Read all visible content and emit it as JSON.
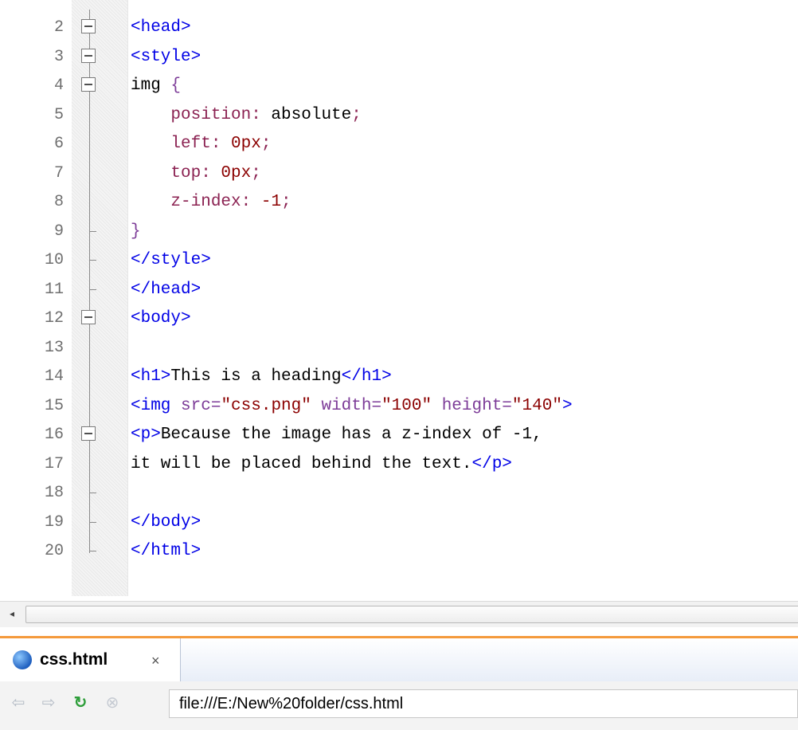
{
  "editor": {
    "lines": [
      {
        "num": "2",
        "fold": "box",
        "tokens": [
          {
            "t": "<head>",
            "c": "tag"
          }
        ]
      },
      {
        "num": "3",
        "fold": "box",
        "tokens": [
          {
            "t": "<style>",
            "c": "tag"
          }
        ]
      },
      {
        "num": "4",
        "fold": "box",
        "tokens": [
          {
            "t": "img ",
            "c": "sel"
          },
          {
            "t": "{",
            "c": "punc"
          }
        ]
      },
      {
        "num": "5",
        "fold": "line",
        "tokens": [
          {
            "t": "    position:",
            "c": "prop"
          },
          {
            "t": " absolute",
            "c": "text"
          },
          {
            "t": ";",
            "c": "prop"
          }
        ]
      },
      {
        "num": "6",
        "fold": "line",
        "tokens": [
          {
            "t": "    left:",
            "c": "prop"
          },
          {
            "t": " 0px",
            "c": "val"
          },
          {
            "t": ";",
            "c": "prop"
          }
        ]
      },
      {
        "num": "7",
        "fold": "line",
        "tokens": [
          {
            "t": "    top:",
            "c": "prop"
          },
          {
            "t": " 0px",
            "c": "val"
          },
          {
            "t": ";",
            "c": "prop"
          }
        ]
      },
      {
        "num": "8",
        "fold": "line",
        "tokens": [
          {
            "t": "    z-index:",
            "c": "prop"
          },
          {
            "t": " -1",
            "c": "val"
          },
          {
            "t": ";",
            "c": "prop"
          }
        ]
      },
      {
        "num": "9",
        "fold": "tick",
        "tokens": [
          {
            "t": "}",
            "c": "punc"
          }
        ]
      },
      {
        "num": "10",
        "fold": "tick",
        "tokens": [
          {
            "t": "</style>",
            "c": "tag"
          }
        ]
      },
      {
        "num": "11",
        "fold": "tick",
        "tokens": [
          {
            "t": "</head>",
            "c": "tag"
          }
        ]
      },
      {
        "num": "12",
        "fold": "box",
        "tokens": [
          {
            "t": "<body>",
            "c": "tag"
          }
        ]
      },
      {
        "num": "13",
        "fold": "line",
        "tokens": []
      },
      {
        "num": "14",
        "fold": "line",
        "tokens": [
          {
            "t": "<h1>",
            "c": "tag"
          },
          {
            "t": "This is a heading",
            "c": "text"
          },
          {
            "t": "</h1>",
            "c": "tag"
          }
        ]
      },
      {
        "num": "15",
        "fold": "line",
        "tokens": [
          {
            "t": "<img ",
            "c": "tag"
          },
          {
            "t": "src=",
            "c": "attr"
          },
          {
            "t": "\"css.png\"",
            "c": "str"
          },
          {
            "t": " width=",
            "c": "attr"
          },
          {
            "t": "\"100\"",
            "c": "str"
          },
          {
            "t": " height=",
            "c": "attr"
          },
          {
            "t": "\"140\"",
            "c": "str"
          },
          {
            "t": ">",
            "c": "tag"
          }
        ]
      },
      {
        "num": "16",
        "fold": "box",
        "tokens": [
          {
            "t": "<p>",
            "c": "tag"
          },
          {
            "t": "Because the image has a z-index of -1,",
            "c": "text"
          }
        ]
      },
      {
        "num": "17",
        "fold": "line",
        "tokens": [
          {
            "t": "it will be placed behind the text.",
            "c": "text"
          },
          {
            "t": "</p>",
            "c": "tag"
          }
        ]
      },
      {
        "num": "18",
        "fold": "tick",
        "tokens": []
      },
      {
        "num": "19",
        "fold": "tick",
        "tokens": [
          {
            "t": "</body>",
            "c": "tag"
          }
        ]
      },
      {
        "num": "20",
        "fold": "end",
        "tokens": [
          {
            "t": "</html>",
            "c": "tag"
          }
        ]
      }
    ]
  },
  "scrollbar": {
    "left_arrow": "◂"
  },
  "browser": {
    "tab": {
      "label": "css.html",
      "close": "×",
      "icon": "globe-icon"
    },
    "nav": {
      "back": "⇦",
      "forward": "⇨",
      "refresh": "↻",
      "stop": "⊗"
    },
    "url": "file:///E:/New%20folder/css.html"
  },
  "colors": {
    "tag": "#0000e6",
    "property": "#8b2252",
    "value": "#8b0000",
    "accent_orange": "#f49a3c",
    "refresh_green": "#2e9e3a",
    "nav_gray": "#b5bcc6"
  }
}
